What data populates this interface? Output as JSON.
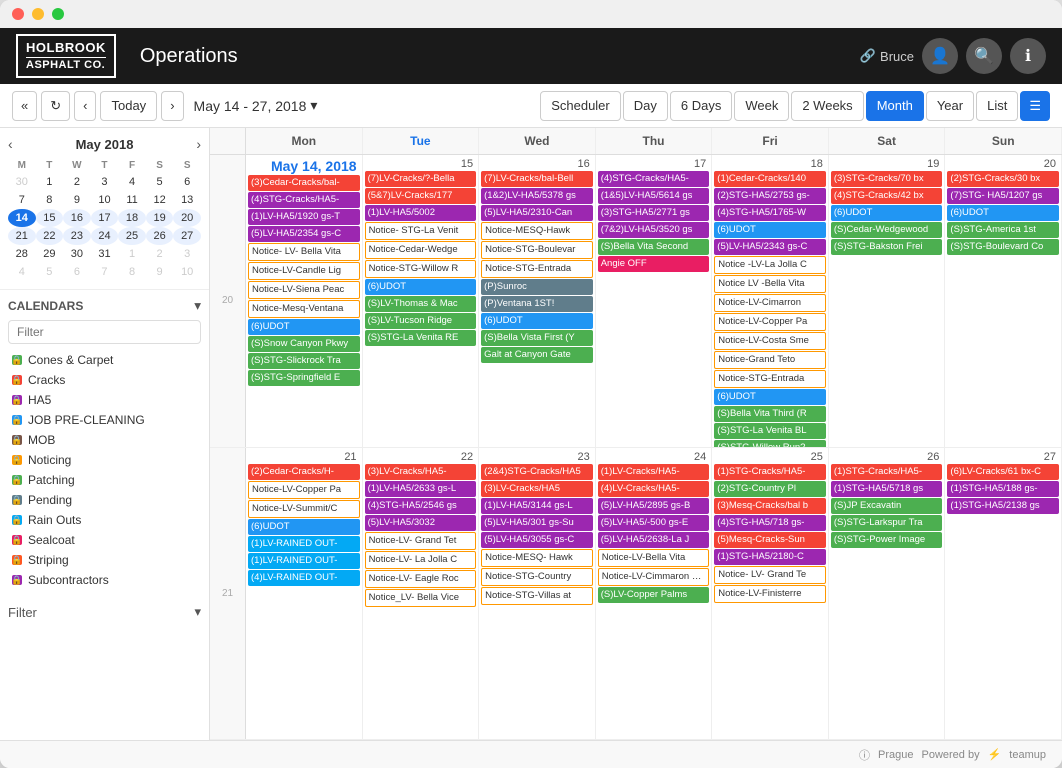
{
  "window": {
    "titlebar": {
      "close": "close",
      "minimize": "minimize",
      "maximize": "maximize"
    }
  },
  "header": {
    "logo_line1": "HOLBROOK",
    "logo_line2": "ASPHALT CO.",
    "title": "Operations",
    "user_icon": "🔗",
    "user_name": "Bruce",
    "search_icon": "🔍",
    "info_icon": "ℹ"
  },
  "toolbar": {
    "prev_prev_label": "«",
    "refresh_label": "↻",
    "prev_label": "‹",
    "today_label": "Today",
    "next_label": "›",
    "range_label": "May 14 - 27, 2018",
    "range_arrow": "▾",
    "scheduler_label": "Scheduler",
    "day_label": "Day",
    "six_days_label": "6 Days",
    "week_label": "Week",
    "two_weeks_label": "2 Weeks",
    "month_label": "Month",
    "year_label": "Year",
    "list_label": "List",
    "menu_icon": "☰"
  },
  "sidebar": {
    "mini_cal": {
      "month": "May",
      "year": "2018",
      "days_header": [
        "M",
        "T",
        "W",
        "T",
        "F",
        "S",
        "S"
      ],
      "weeks": [
        [
          30,
          1,
          2,
          3,
          4,
          5,
          6
        ],
        [
          7,
          8,
          9,
          10,
          11,
          12,
          13
        ],
        [
          14,
          15,
          16,
          17,
          18,
          19,
          20
        ],
        [
          21,
          22,
          23,
          24,
          25,
          26,
          27
        ],
        [
          28,
          29,
          30,
          31,
          1,
          2,
          3
        ],
        [
          4,
          5,
          6,
          7,
          8,
          9,
          10
        ]
      ],
      "today": 14,
      "other_month_before": [
        30
      ],
      "other_month_after": [
        1,
        2,
        3,
        4,
        5,
        6,
        7,
        8,
        9,
        10
      ]
    },
    "calendars_label": "Calendars",
    "filter_placeholder": "Filter",
    "calendars": [
      {
        "name": "Cones & Carpet",
        "color": "#4CAF50"
      },
      {
        "name": "Cracks",
        "color": "#F44336"
      },
      {
        "name": "HA5",
        "color": "#9C27B0"
      },
      {
        "name": "JOB PRE-CLEANING",
        "color": "#2196F3"
      },
      {
        "name": "MOB",
        "color": "#795548"
      },
      {
        "name": "Noticing",
        "color": "#FF9800"
      },
      {
        "name": "Patching",
        "color": "#4CAF50"
      },
      {
        "name": "Pending",
        "color": "#607D8B"
      },
      {
        "name": "Rain Outs",
        "color": "#03A9F4"
      },
      {
        "name": "Sealcoat",
        "color": "#E91E63"
      },
      {
        "name": "Striping",
        "color": "#FF5722"
      },
      {
        "name": "Subcontractors",
        "color": "#9C27B0"
      }
    ],
    "filter_label": "Filter",
    "collapse_icon": "▾"
  },
  "calendar": {
    "day_headers": [
      "Mon",
      "Tue",
      "Wed",
      "Thu",
      "Fri",
      "Sat",
      "Sun"
    ],
    "week1": {
      "week_num": "20",
      "dates": [
        "14",
        "15",
        "16",
        "17",
        "18",
        "19",
        "20"
      ],
      "today_date": "14",
      "events": {
        "mon": [
          {
            "text": "(3)Cedar-Cracks/bal-",
            "color": "#F44336"
          },
          {
            "text": "(4)STG-Cracks/HA5-",
            "color": "#9C27B0"
          },
          {
            "text": "(1)LV-HA5/1920 gs-T",
            "color": "#9C27B0"
          },
          {
            "text": "(5)LV-HA5/2354 gs-C",
            "color": "#9C27B0"
          },
          {
            "text": "Notice- LV- Bella Vita",
            "color": "#FF9800",
            "outline": true
          },
          {
            "text": "Notice-LV-Candle Lig",
            "color": "#FF9800",
            "outline": true
          },
          {
            "text": "Notice-LV-Siena Peac",
            "color": "#FF9800",
            "outline": true
          },
          {
            "text": "Notice-Mesq-Ventana",
            "color": "#FF9800",
            "outline": true
          },
          {
            "text": "(6)UDOT",
            "color": "#2196F3"
          },
          {
            "text": "(S)Snow Canyon Pkwy",
            "color": "#4CAF50"
          },
          {
            "text": "(S)STG-Slickrock Tra",
            "color": "#4CAF50"
          },
          {
            "text": "(S)STG-Springfield E",
            "color": "#4CAF50"
          }
        ],
        "tue": [
          {
            "text": "(7)LV-Cracks/?-Bella",
            "color": "#F44336"
          },
          {
            "text": "(5&7)LV-Cracks/177",
            "color": "#F44336"
          },
          {
            "text": "(1)LV-HA5/5002",
            "color": "#9C27B0"
          },
          {
            "text": "Notice- STG-La Venit",
            "color": "#FF9800",
            "outline": true
          },
          {
            "text": "Notice-Cedar-Wedge",
            "color": "#FF9800",
            "outline": true
          },
          {
            "text": "Notice-STG-Willow R",
            "color": "#FF9800",
            "outline": true
          },
          {
            "text": "(6)UDOT",
            "color": "#2196F3"
          },
          {
            "text": "(S)LV-Thomas & Mac",
            "color": "#4CAF50"
          },
          {
            "text": "(S)LV-Tucson Ridge",
            "color": "#4CAF50"
          },
          {
            "text": "(S)STG-La Venita RE",
            "color": "#4CAF50"
          }
        ],
        "wed": [
          {
            "text": "(7)LV-Cracks/bal-Bell",
            "color": "#F44336"
          },
          {
            "text": "(1&2)LV-HA5/5378 gs",
            "color": "#9C27B0"
          },
          {
            "text": "(5)LV-HA5/2310-Can",
            "color": "#9C27B0"
          },
          {
            "text": "Notice-MESQ-Hawk",
            "color": "#FF9800",
            "outline": true
          },
          {
            "text": "Notice-STG-Boulevar",
            "color": "#FF9800",
            "outline": true
          },
          {
            "text": "Notice-STG-Entrada",
            "color": "#FF9800",
            "outline": true
          },
          {
            "text": "(P)Sunroc",
            "color": "#607D8B"
          },
          {
            "text": "(P)Ventana 1ST!",
            "color": "#607D8B"
          },
          {
            "text": "(6)UDOT",
            "color": "#2196F3"
          },
          {
            "text": "(S)Bella Vista First (Y",
            "color": "#4CAF50"
          },
          {
            "text": "Galt at Canyon Gate",
            "color": "#4CAF50"
          }
        ],
        "thu": [
          {
            "text": "(4)STG-Cracks/HA5-",
            "color": "#9C27B0"
          },
          {
            "text": "(1&5)LV-HA5/5614 gs",
            "color": "#9C27B0"
          },
          {
            "text": "(3)STG-HA5/2771 gs",
            "color": "#9C27B0"
          },
          {
            "text": "(7&2)LV-HA5/3520 gs",
            "color": "#9C27B0"
          },
          {
            "text": "(S)Bella Vita Second",
            "color": "#4CAF50"
          },
          {
            "text": "Angie OFF",
            "color": "#E91E63"
          }
        ],
        "fri": [
          {
            "text": "(1)Cedar-Cracks/140",
            "color": "#F44336"
          },
          {
            "text": "(2)STG-HA5/2753 gs-",
            "color": "#9C27B0"
          },
          {
            "text": "(4)STG-HA5/1765-W",
            "color": "#9C27B0"
          },
          {
            "text": "(6)UDOT",
            "color": "#2196F3"
          },
          {
            "text": "(5)LV-HA5/2343 gs-C",
            "color": "#9C27B0"
          },
          {
            "text": "Notice -LV-La Jolla C",
            "color": "#FF9800",
            "outline": true
          },
          {
            "text": "Notice LV -Bella Vita",
            "color": "#FF9800",
            "outline": true
          },
          {
            "text": "Notice-LV-Cimarron",
            "color": "#FF9800",
            "outline": true
          },
          {
            "text": "Notice-LV-Copper Pa",
            "color": "#FF9800",
            "outline": true
          },
          {
            "text": "Notice-LV-Costa Sme",
            "color": "#FF9800",
            "outline": true
          },
          {
            "text": "Notice-Grand Teto",
            "color": "#FF9800",
            "outline": true
          },
          {
            "text": "Notice-STG-Entrada",
            "color": "#FF9800",
            "outline": true
          },
          {
            "text": "(6)UDOT",
            "color": "#2196F3"
          },
          {
            "text": "(S)Bella Vita Third (R",
            "color": "#4CAF50"
          },
          {
            "text": "(S)STG-La Venita BL",
            "color": "#4CAF50"
          },
          {
            "text": "(S)STG-Willow Run?",
            "color": "#4CAF50"
          }
        ],
        "sat": [
          {
            "text": "(3)STG-Cracks/70 bx",
            "color": "#F44336"
          },
          {
            "text": "(4)STG-Cracks/42 bx",
            "color": "#F44336"
          },
          {
            "text": "(6)UDOT",
            "color": "#2196F3"
          },
          {
            "text": "(S)Cedar-Wedgewood",
            "color": "#4CAF50"
          },
          {
            "text": "(S)STG-Bakston Frei",
            "color": "#4CAF50"
          }
        ],
        "sun": [
          {
            "text": "(2)STG-Cracks/30 bx",
            "color": "#F44336"
          },
          {
            "text": "(7)STG- HA5/1207 gs",
            "color": "#9C27B0"
          },
          {
            "text": "(6)UDOT",
            "color": "#2196F3"
          },
          {
            "text": "(S)STG-America 1st",
            "color": "#4CAF50"
          },
          {
            "text": "(S)STG-Boulevard Co",
            "color": "#4CAF50"
          }
        ]
      }
    },
    "week2": {
      "week_num": "21",
      "dates": [
        "21",
        "22",
        "23",
        "24",
        "25",
        "26",
        "27"
      ],
      "events": {
        "mon": [
          {
            "text": "(2)Cedar-Cracks/H-",
            "color": "#F44336"
          },
          {
            "text": "Notice-LV-Copper Pa",
            "color": "#FF9800",
            "outline": true
          },
          {
            "text": "Notice-LV-Summit/C",
            "color": "#FF9800",
            "outline": true
          },
          {
            "text": "(6)UDOT",
            "color": "#2196F3"
          },
          {
            "text": "(1)LV-RAINED OUT-",
            "color": "#03A9F4"
          },
          {
            "text": "(1)LV-RAINED OUT-",
            "color": "#03A9F4"
          },
          {
            "text": "(4)LV-RAINED OUT-",
            "color": "#03A9F4"
          }
        ],
        "tue": [
          {
            "text": "(3)LV-Cracks/HA5-",
            "color": "#F44336"
          },
          {
            "text": "(1)LV-HA5/2633 gs-L",
            "color": "#9C27B0"
          },
          {
            "text": "(4)STG-HA5/2546 gs",
            "color": "#9C27B0"
          },
          {
            "text": "(5)LV-HA5/3032",
            "color": "#9C27B0"
          },
          {
            "text": "Notice-LV- Grand Tet",
            "color": "#FF9800",
            "outline": true
          },
          {
            "text": "Notice-LV- La Jolla C",
            "color": "#FF9800",
            "outline": true
          },
          {
            "text": "Notice-LV- Eagle Roc",
            "color": "#FF9800",
            "outline": true
          },
          {
            "text": "Notice_LV- Bella Vice",
            "color": "#FF9800",
            "outline": true
          }
        ],
        "wed": [
          {
            "text": "(2&4)STG-Cracks/HA5",
            "color": "#F44336"
          },
          {
            "text": "(3)LV-Cracks/HA5",
            "color": "#F44336"
          },
          {
            "text": "(1)LV-HA5/3144 gs-L",
            "color": "#9C27B0"
          },
          {
            "text": "(5)LV-HA5/301 gs-Su",
            "color": "#9C27B0"
          },
          {
            "text": "(5)LV-HA5/3055 gs-C",
            "color": "#9C27B0"
          },
          {
            "text": "Notice-MESQ- Hawk",
            "color": "#FF9800",
            "outline": true
          },
          {
            "text": "Notice-STG-Country",
            "color": "#FF9800",
            "outline": true
          },
          {
            "text": "Notice-STG-Villas at",
            "color": "#FF9800",
            "outline": true
          }
        ],
        "thu": [
          {
            "text": "(1)LV-Cracks/HA5-",
            "color": "#F44336"
          },
          {
            "text": "(4)LV-Cracks/HA5-",
            "color": "#F44336"
          },
          {
            "text": "(5)LV-HA5/2895 gs-B",
            "color": "#9C27B0"
          },
          {
            "text": "(5)LV-HA5/-500 gs-E",
            "color": "#9C27B0"
          },
          {
            "text": "(5)LV-HA5/2638-La J",
            "color": "#9C27B0"
          },
          {
            "text": "Notice-LV-Bella Vita",
            "color": "#FF9800",
            "outline": true
          },
          {
            "text": "Notice-LV-Cimmaron Wes",
            "color": "#FF9800",
            "outline": true
          },
          {
            "text": "(S)LV-Copper Palms",
            "color": "#4CAF50"
          }
        ],
        "fri": [
          {
            "text": "(1)STG-Cracks/HA5-",
            "color": "#F44336"
          },
          {
            "text": "(2)STG-Country Pl",
            "color": "#4CAF50"
          },
          {
            "text": "(3)Mesq-Cracks/bal b",
            "color": "#F44336"
          },
          {
            "text": "(4)STG-HA5/718 gs-",
            "color": "#9C27B0"
          },
          {
            "text": "(5)Mesq-Cracks-Sun",
            "color": "#F44336"
          },
          {
            "text": "(1)STG-HA5/2180-C",
            "color": "#9C27B0"
          },
          {
            "text": "Notice- LV- Grand Te",
            "color": "#FF9800",
            "outline": true
          },
          {
            "text": "Notice-LV-Finisterre",
            "color": "#FF9800",
            "outline": true
          }
        ],
        "sat": [
          {
            "text": "(1)STG-Cracks/HA5-",
            "color": "#F44336"
          },
          {
            "text": "(1)STG-HA5/5718 gs",
            "color": "#9C27B0"
          },
          {
            "text": "(S)JP Excavatin",
            "color": "#4CAF50"
          },
          {
            "text": "(S)STG-Larkspur Tra",
            "color": "#4CAF50"
          },
          {
            "text": "(S)STG-Power Image",
            "color": "#4CAF50"
          }
        ],
        "sun": [
          {
            "text": "(6)LV-Cracks/61 bx-C",
            "color": "#F44336"
          },
          {
            "text": "(1)STG-HA5/188 gs-",
            "color": "#9C27B0"
          },
          {
            "text": "(1)STG-HA5/2138 gs",
            "color": "#9C27B0"
          }
        ]
      }
    }
  },
  "footer": {
    "location": "Prague",
    "powered_by": "Powered by",
    "brand": "teamup"
  }
}
